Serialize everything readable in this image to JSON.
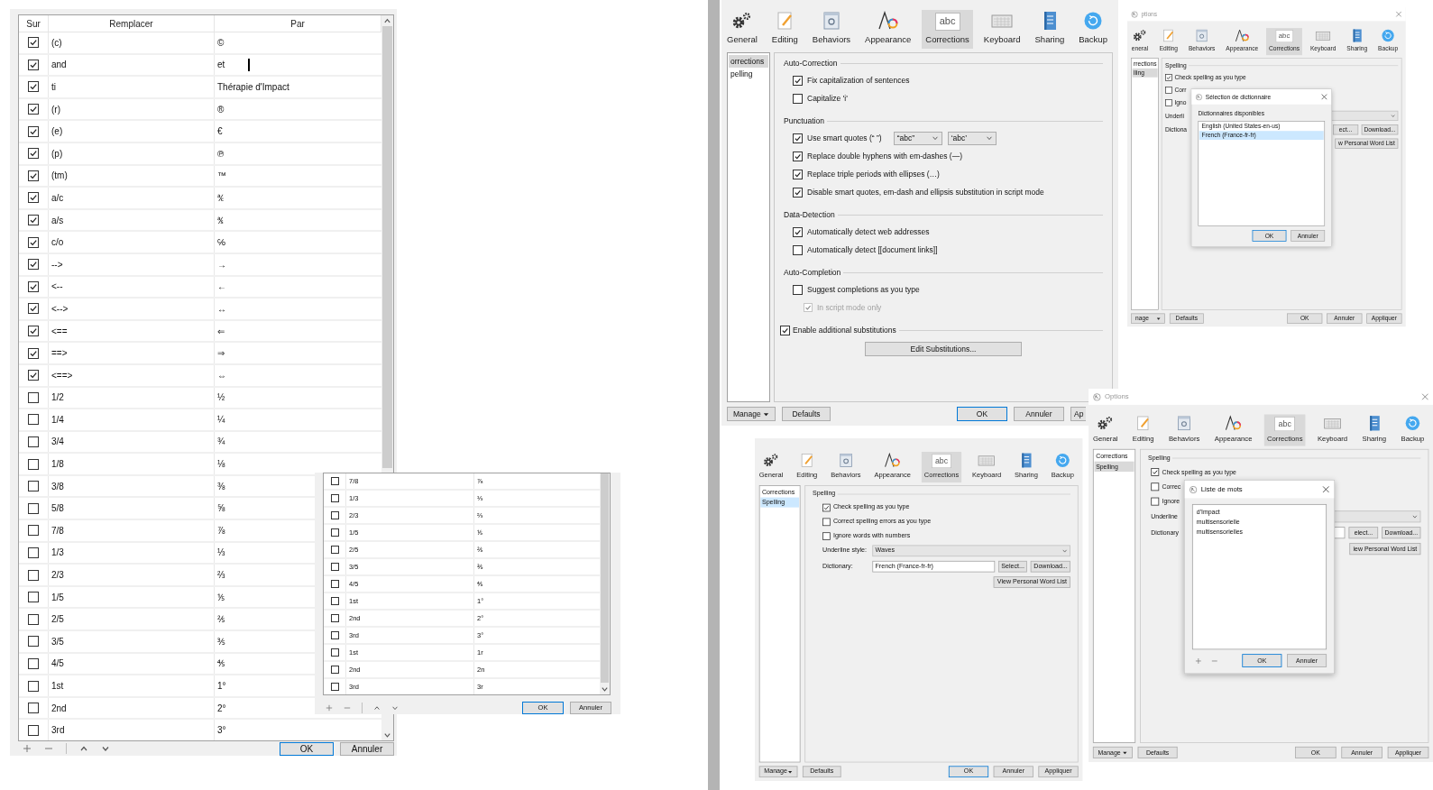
{
  "substitutions": {
    "columns": [
      "Sur",
      "Remplacer",
      "Par"
    ],
    "rows": [
      {
        "replace": "(c)",
        "with": "©",
        "checked": true,
        "editing": false
      },
      {
        "replace": "and",
        "with": "et",
        "checked": true,
        "editing": true
      },
      {
        "replace": "ti",
        "with": "Thérapie d'Impact",
        "checked": true,
        "editing": false
      },
      {
        "replace": "(r)",
        "with": "®",
        "checked": true,
        "editing": false
      },
      {
        "replace": "(e)",
        "with": "€",
        "checked": true,
        "editing": false
      },
      {
        "replace": "(p)",
        "with": "℗",
        "checked": true,
        "editing": false
      },
      {
        "replace": "(tm)",
        "with": "™",
        "checked": true,
        "editing": false
      },
      {
        "replace": "a/c",
        "with": "℀",
        "checked": true,
        "editing": false
      },
      {
        "replace": "a/s",
        "with": "℁",
        "checked": true,
        "editing": false
      },
      {
        "replace": "c/o",
        "with": "℅",
        "checked": true,
        "editing": false
      },
      {
        "replace": "-->",
        "with": "→",
        "checked": true,
        "editing": false
      },
      {
        "replace": "<--",
        "with": "←",
        "checked": true,
        "editing": false
      },
      {
        "replace": "<-->",
        "with": "↔",
        "checked": true,
        "editing": false
      },
      {
        "replace": "<==",
        "with": "⇐",
        "checked": true,
        "editing": false
      },
      {
        "replace": "==>",
        "with": "⇒",
        "checked": true,
        "editing": false
      },
      {
        "replace": "<==>",
        "with": "⇔",
        "checked": true,
        "editing": false
      },
      {
        "replace": "1/2",
        "with": "½",
        "checked": false,
        "editing": false
      },
      {
        "replace": "1/4",
        "with": "¼",
        "checked": false,
        "editing": false
      },
      {
        "replace": "3/4",
        "with": "¾",
        "checked": false,
        "editing": false
      },
      {
        "replace": "1/8",
        "with": "⅛",
        "checked": false,
        "editing": false
      },
      {
        "replace": "3/8",
        "with": "⅜",
        "checked": false,
        "editing": false
      },
      {
        "replace": "5/8",
        "with": "⅝",
        "checked": false,
        "editing": false
      },
      {
        "replace": "7/8",
        "with": "⅞",
        "checked": false,
        "editing": false
      },
      {
        "replace": "1/3",
        "with": "⅓",
        "checked": false,
        "editing": false
      },
      {
        "replace": "2/3",
        "with": "⅔",
        "checked": false,
        "editing": false
      },
      {
        "replace": "1/5",
        "with": "⅕",
        "checked": false,
        "editing": false
      },
      {
        "replace": "2/5",
        "with": "⅖",
        "checked": false,
        "editing": false
      },
      {
        "replace": "3/5",
        "with": "⅗",
        "checked": false,
        "editing": false
      },
      {
        "replace": "4/5",
        "with": "⅘",
        "checked": false,
        "editing": false
      },
      {
        "replace": "1st",
        "with": "1°",
        "checked": false,
        "editing": false
      },
      {
        "replace": "2nd",
        "with": "2°",
        "checked": false,
        "editing": false
      },
      {
        "replace": "3rd",
        "with": "3°",
        "checked": false,
        "editing": false
      }
    ],
    "buttons": [
      {
        "label": "OK",
        "kind": "default"
      },
      {
        "label": "Annuler",
        "kind": "plain"
      }
    ]
  },
  "substitutions_overlay": {
    "rows": [
      {
        "replace": "7/8",
        "with": "⅞",
        "checked": false,
        "editing": false
      },
      {
        "replace": "1/3",
        "with": "⅓",
        "checked": false,
        "editing": false
      },
      {
        "replace": "2/3",
        "with": "⅔",
        "checked": false,
        "editing": false
      },
      {
        "replace": "1/5",
        "with": "⅕",
        "checked": false,
        "editing": false
      },
      {
        "replace": "2/5",
        "with": "⅖",
        "checked": false,
        "editing": false
      },
      {
        "replace": "3/5",
        "with": "⅗",
        "checked": false,
        "editing": false
      },
      {
        "replace": "4/5",
        "with": "⅘",
        "checked": false,
        "editing": false
      },
      {
        "replace": "1st",
        "with": "1°",
        "checked": false,
        "editing": false
      },
      {
        "replace": "2nd",
        "with": "2°",
        "checked": false,
        "editing": false
      },
      {
        "replace": "3rd",
        "with": "3°",
        "checked": false,
        "editing": false
      },
      {
        "replace": "1st",
        "with": "1r",
        "checked": false,
        "editing": false
      },
      {
        "replace": "2nd",
        "with": "2n",
        "checked": false,
        "editing": false
      },
      {
        "replace": "3rd",
        "with": "3r",
        "checked": false,
        "editing": false
      }
    ],
    "buttons": [
      {
        "label": "OK",
        "kind": "default"
      },
      {
        "label": "Annuler",
        "kind": "plain"
      }
    ]
  },
  "corrections_window": {
    "focused": false,
    "toolbar": [
      {
        "label": "General",
        "selected": false
      },
      {
        "label": "Editing",
        "selected": false
      },
      {
        "label": "Behaviors",
        "selected": false
      },
      {
        "label": "Appearance",
        "selected": false
      },
      {
        "label": "Corrections",
        "selected": true,
        "icon_text": "abc"
      },
      {
        "label": "Keyboard",
        "selected": false
      },
      {
        "label": "Sharing",
        "selected": false
      },
      {
        "label": "Backup",
        "selected": false
      }
    ],
    "sidebar": [
      {
        "label": "orrections",
        "selected": true
      },
      {
        "label": "pelling",
        "selected": false
      }
    ],
    "sections": [
      {
        "title": "Auto-Correction",
        "options": [
          {
            "kind": "checkbox",
            "label": "Fix capitalization of sentences",
            "checked": true,
            "disabled": false
          },
          {
            "kind": "checkbox",
            "label": "Capitalize 'i'",
            "checked": false,
            "disabled": false
          }
        ]
      },
      {
        "title": "Punctuation",
        "options": [
          {
            "kind": "quotes",
            "label": "Use smart quotes (“ ”)",
            "checked": true,
            "disabled": false,
            "choices": [
              "“abc”",
              "‘abc’"
            ]
          },
          {
            "kind": "checkbox",
            "label": "Replace double hyphens with em-dashes (—)",
            "checked": true,
            "disabled": false
          },
          {
            "kind": "checkbox",
            "label": "Replace triple periods with ellipses (…)",
            "checked": true,
            "disabled": false
          },
          {
            "kind": "checkbox",
            "label": "Disable smart quotes, em-dash and ellipsis substitution in script mode",
            "checked": true,
            "disabled": false
          }
        ]
      },
      {
        "title": "Data-Detection",
        "options": [
          {
            "kind": "checkbox",
            "label": "Automatically detect web addresses",
            "checked": true,
            "disabled": false
          },
          {
            "kind": "checkbox",
            "label": "Automatically detect [[document links]]",
            "checked": false,
            "disabled": false
          }
        ]
      },
      {
        "title": "Auto-Completion",
        "options": [
          {
            "kind": "checkbox",
            "label": "Suggest completions as you type",
            "checked": false,
            "disabled": false
          },
          {
            "kind": "subcheckbox",
            "label": "In script mode only",
            "checked": true,
            "disabled": true
          }
        ]
      },
      {
        "title": "Enable additional substitutions",
        "checked": true,
        "button": "Edit Substitutions..."
      }
    ],
    "footer_left": [
      {
        "label": "Manage",
        "kind": "menu"
      },
      {
        "label": "Defaults",
        "kind": "plain"
      }
    ],
    "footer_right": [
      {
        "label": "OK",
        "kind": "default"
      },
      {
        "label": "Annuler",
        "kind": "plain"
      },
      {
        "label": "Ap",
        "kind": "partial"
      }
    ]
  },
  "dictionary_window": {
    "title": "ptions",
    "focused": false,
    "toolbar": [
      {
        "label": "eneral",
        "selected": false
      },
      {
        "label": "Editing",
        "selected": false
      },
      {
        "label": "Behaviors",
        "selected": false
      },
      {
        "label": "Appearance",
        "selected": false
      },
      {
        "label": "Corrections",
        "selected": true,
        "icon_text": "abc"
      },
      {
        "label": "Keyboard",
        "selected": false
      },
      {
        "label": "Sharing",
        "selected": false
      },
      {
        "label": "Backup",
        "selected": false
      }
    ],
    "sidebar": [
      {
        "label": "rrections",
        "selected": false
      },
      {
        "label": "lling",
        "selected": true
      }
    ],
    "spelling": {
      "group": "Spelling",
      "checks": [
        {
          "label": "Check spelling as you type",
          "checked": true
        },
        {
          "label": "Corr",
          "checked": false
        },
        {
          "label": "Igno",
          "checked": false
        }
      ],
      "underline": {
        "label": "Underli"
      },
      "dictionary": {
        "label": "Dictiona"
      },
      "buttons": [
        "ect...",
        "Download..."
      ],
      "word_list": "w Personal Word List"
    },
    "footer_left": [
      {
        "label": "nage",
        "kind": "menu"
      },
      {
        "label": "Defaults",
        "kind": "plain"
      }
    ],
    "footer_right": [
      {
        "label": "OK",
        "kind": "plain"
      },
      {
        "label": "Annuler",
        "kind": "plain"
      },
      {
        "label": "Appliquer",
        "kind": "plain"
      }
    ],
    "dialog": {
      "title": "Sélection de dictionnaire",
      "label": "Dictionnaires disponibles",
      "items": [
        {
          "label": "English (United States-en-us)",
          "selected": false
        },
        {
          "label": "French (France-fr-fr)",
          "selected": true
        }
      ],
      "buttons": [
        {
          "label": "OK",
          "kind": "default"
        },
        {
          "label": "Annuler",
          "kind": "plain"
        }
      ]
    }
  },
  "spelling_window": {
    "focused": true,
    "toolbar": [
      {
        "label": "General",
        "selected": false
      },
      {
        "label": "Editing",
        "selected": false
      },
      {
        "label": "Behaviors",
        "selected": false
      },
      {
        "label": "Appearance",
        "selected": false
      },
      {
        "label": "Corrections",
        "selected": true,
        "icon_text": "abc"
      },
      {
        "label": "Keyboard",
        "selected": false
      },
      {
        "label": "Sharing",
        "selected": false
      },
      {
        "label": "Backup",
        "selected": false
      }
    ],
    "sidebar": [
      {
        "label": "Corrections",
        "selected": false
      },
      {
        "label": "Spelling",
        "selected": true
      }
    ],
    "spelling": {
      "group": "Spelling",
      "checks": [
        {
          "label": "Check spelling as you type",
          "checked": true
        },
        {
          "label": "Correct spelling errors as you type",
          "checked": false
        },
        {
          "label": "Ignore words with numbers",
          "checked": false
        }
      ],
      "underline": {
        "label": "Underline style:",
        "value": "Waves"
      },
      "dictionary": {
        "label": "Dictionary:",
        "value": "French (France-fr-fr)"
      },
      "buttons": [
        "Select...",
        "Download..."
      ],
      "word_list": "View Personal Word List"
    },
    "footer_left": [
      {
        "label": "Manage",
        "kind": "menu"
      },
      {
        "label": "Defaults",
        "kind": "plain"
      }
    ],
    "footer_right": [
      {
        "label": "OK",
        "kind": "default"
      },
      {
        "label": "Annuler",
        "kind": "plain"
      },
      {
        "label": "Appliquer",
        "kind": "plain"
      }
    ]
  },
  "word_list_window": {
    "title": "Options",
    "focused": false,
    "toolbar": [
      {
        "label": "General",
        "selected": false
      },
      {
        "label": "Editing",
        "selected": false
      },
      {
        "label": "Behaviors",
        "selected": false
      },
      {
        "label": "Appearance",
        "selected": false
      },
      {
        "label": "Corrections",
        "selected": true,
        "icon_text": "abc"
      },
      {
        "label": "Keyboard",
        "selected": false
      },
      {
        "label": "Sharing",
        "selected": false
      },
      {
        "label": "Backup",
        "selected": false
      }
    ],
    "sidebar": [
      {
        "label": "Corrections",
        "selected": false
      },
      {
        "label": "Spelling",
        "selected": true
      }
    ],
    "spelling": {
      "group": "Spelling",
      "checks": [
        {
          "label": "Check spelling as you type",
          "checked": true
        },
        {
          "label": "Correc",
          "checked": false
        },
        {
          "label": "Ignore",
          "checked": false
        }
      ],
      "underline": {
        "label": "Underline"
      },
      "dictionary": {
        "label": "Dictionary"
      },
      "buttons": [
        "elect...",
        "Download..."
      ],
      "word_list": "iew Personal Word List"
    },
    "footer_left": [
      {
        "label": "Manage",
        "kind": "menu"
      },
      {
        "label": "Defaults",
        "kind": "plain"
      }
    ],
    "footer_right": [
      {
        "label": "OK",
        "kind": "plain"
      },
      {
        "label": "Annuler",
        "kind": "plain"
      },
      {
        "label": "Appliquer",
        "kind": "plain"
      }
    ],
    "dialog": {
      "title": "Liste de mots",
      "words": [
        "d'Impact",
        "multisensorielle",
        "multisensorielles"
      ],
      "buttons": [
        {
          "label": "OK",
          "kind": "default"
        },
        {
          "label": "Annuler",
          "kind": "plain"
        }
      ]
    }
  }
}
